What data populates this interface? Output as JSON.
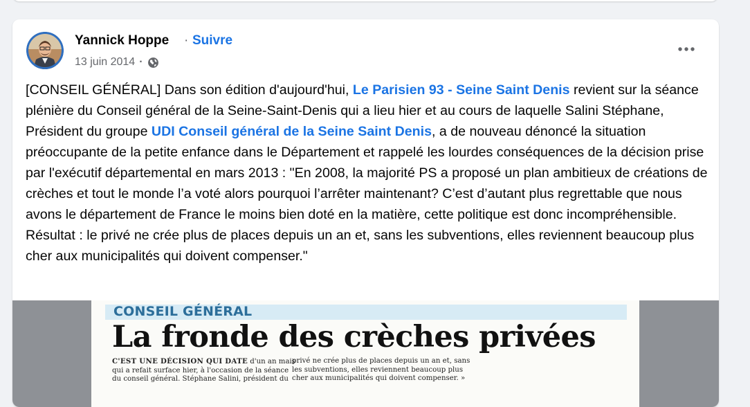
{
  "post": {
    "author": "Yannick Hoppe",
    "separator": "·",
    "follow_label": "Suivre",
    "date": "13 juin 2014",
    "meta_separator": "·",
    "audience_icon": "globe-icon",
    "more_icon": "more-horizontal-icon",
    "text": {
      "t1": "[CONSEIL GÉNÉRAL] Dans son édition d'aujourd'hui, ",
      "link1": "Le Parisien 93 - Seine Saint Denis",
      "t2": " revient sur la séance plénière du Conseil général de la Seine-Saint-Denis qui a lieu hier et au cours de laquelle Salini Stéphane, Président du groupe ",
      "link2": "UDI Conseil général de la Seine Saint Denis",
      "t3": ", a de nouveau dénoncé la situation préoccupante de la petite enfance dans le Département et rappelé les lourdes conséquences de la décision prise par l'exécutif départemental en mars 2013 : \"En 2008, la majorité PS a proposé un plan ambitieux de créations de crèches et tout le monde l’a voté alors pourquoi l’arrêter maintenant? C’est d’autant plus regrettable que nous avons le département de France le moins bien doté en la matière, cette politique est donc incompréhensible. Résultat : le privé ne crée plus de places depuis un an et, sans les subventions, elles reviennent beaucoup plus cher aux municipalités qui doivent compenser.\""
    }
  },
  "clipping": {
    "kicker": "CONSEIL GÉNÉRAL",
    "headline": "La fronde des crèches privées",
    "col1": {
      "lead": "C'EST UNE DÉCISION QUI DATE",
      "line1_rest": " d'un an mais",
      "line2": "qui a refait surface hier, à l'occasion de la séance",
      "line3": "du conseil général. Stéphane Salini, président du"
    },
    "col2": {
      "line1": "privé ne crée plus de places depuis un an et, sans",
      "line2": "les subventions, elles reviennent beaucoup plus",
      "line3": "cher aux municipalités qui doivent compenser. »"
    }
  },
  "colors": {
    "link": "#1b74e4",
    "text": "#050505",
    "secondary": "#65676b",
    "kicker": "#2c6e9a"
  }
}
